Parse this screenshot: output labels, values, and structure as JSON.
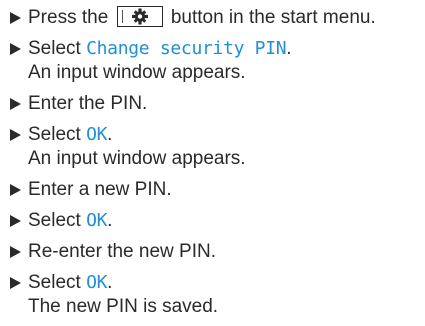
{
  "steps": [
    {
      "before": "Press the",
      "icon": "gear-icon",
      "after": "button in the start menu."
    },
    {
      "prefix": "Select",
      "term": "Change security PIN",
      "suffix": ".",
      "result": "An input window appears."
    },
    {
      "text": "Enter the PIN."
    },
    {
      "prefix": "Select",
      "term": "OK",
      "suffix": ".",
      "result": "An input window appears."
    },
    {
      "text": "Enter a new PIN."
    },
    {
      "prefix": "Select",
      "term": "OK",
      "suffix": "."
    },
    {
      "text": "Re-enter the new PIN."
    },
    {
      "prefix": "Select",
      "term": "OK",
      "suffix": ".",
      "result": "The new PIN is saved."
    }
  ],
  "colors": {
    "ui_term": "#1f8fd6",
    "text": "#2a2a2a"
  }
}
